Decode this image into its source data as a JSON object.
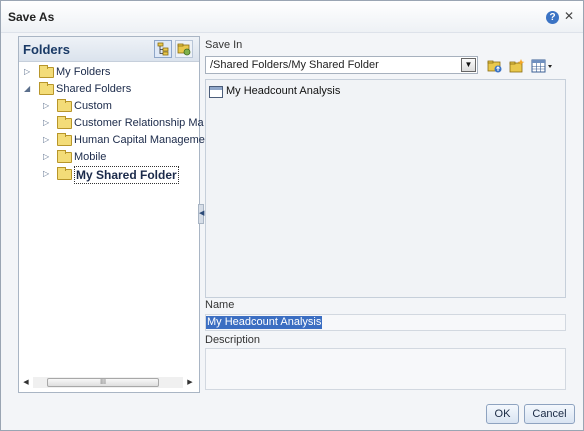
{
  "dialog": {
    "title": "Save As"
  },
  "folders": {
    "title": "Folders",
    "tree": [
      {
        "label": "My Folders"
      },
      {
        "label": "Shared Folders"
      },
      {
        "label": "Custom"
      },
      {
        "label": "Customer Relationship Ma"
      },
      {
        "label": "Human Capital Manageme"
      },
      {
        "label": "Mobile"
      },
      {
        "label": "My Shared Folder"
      }
    ],
    "scrollbar_grip": "III"
  },
  "save_in": {
    "label": "Save In",
    "path": "/Shared Folders/My Shared Folder",
    "items": [
      {
        "label": "My Headcount Analysis"
      }
    ]
  },
  "name": {
    "label": "Name",
    "value": "My Headcount Analysis"
  },
  "description": {
    "label": "Description",
    "value": ""
  },
  "buttons": {
    "ok": "OK",
    "cancel": "Cancel"
  },
  "icons": {
    "help": "help-icon",
    "close": "close-icon",
    "tree_view": "tree-view-icon",
    "folder_view": "folder-view-icon",
    "folder_up": "folder-up-icon",
    "new_folder": "new-folder-icon",
    "view_options": "view-options-icon"
  },
  "colors": {
    "accent": "#3b6ec2",
    "title_text": "#1a3a66",
    "folder": "#f3dc78"
  }
}
